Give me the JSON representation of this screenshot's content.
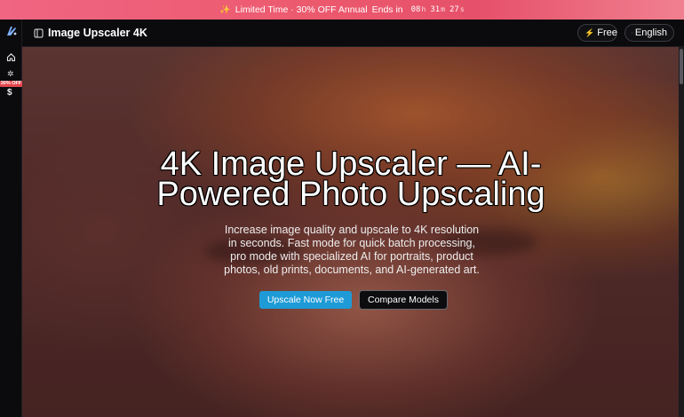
{
  "promo": {
    "text": "Limited Time · 30% OFF Annual",
    "ends_label": "Ends in",
    "hours": "08",
    "hours_unit": "h",
    "minutes": "31",
    "minutes_unit": "m",
    "seconds": "27",
    "seconds_unit": "s"
  },
  "rail": {
    "badge": "30% OFF",
    "dollar": "$"
  },
  "header": {
    "title": "Image Upscaler 4K",
    "free_label": "Free",
    "language_label": "English"
  },
  "hero": {
    "headline": "4K Image Upscaler — AI-Powered Photo Upscaling",
    "subtext": "Increase image quality and upscale to 4K resolution in seconds. Fast mode for quick batch processing, pro mode with specialized AI for portraits, product photos, old prints, documents, and AI-generated art.",
    "primary_button": "Upscale Now Free",
    "secondary_button": "Compare Models"
  },
  "colors": {
    "promo_bg": "#ec5a6e",
    "primary_button": "#1e9bd7",
    "badge": "#e5484d",
    "bolt": "#f5c542"
  },
  "icons": [
    "logo-icon",
    "home-icon",
    "sparkle-gear-icon",
    "dollar-icon",
    "sidebar-panel-icon",
    "bolt-icon",
    "globe-icon"
  ]
}
